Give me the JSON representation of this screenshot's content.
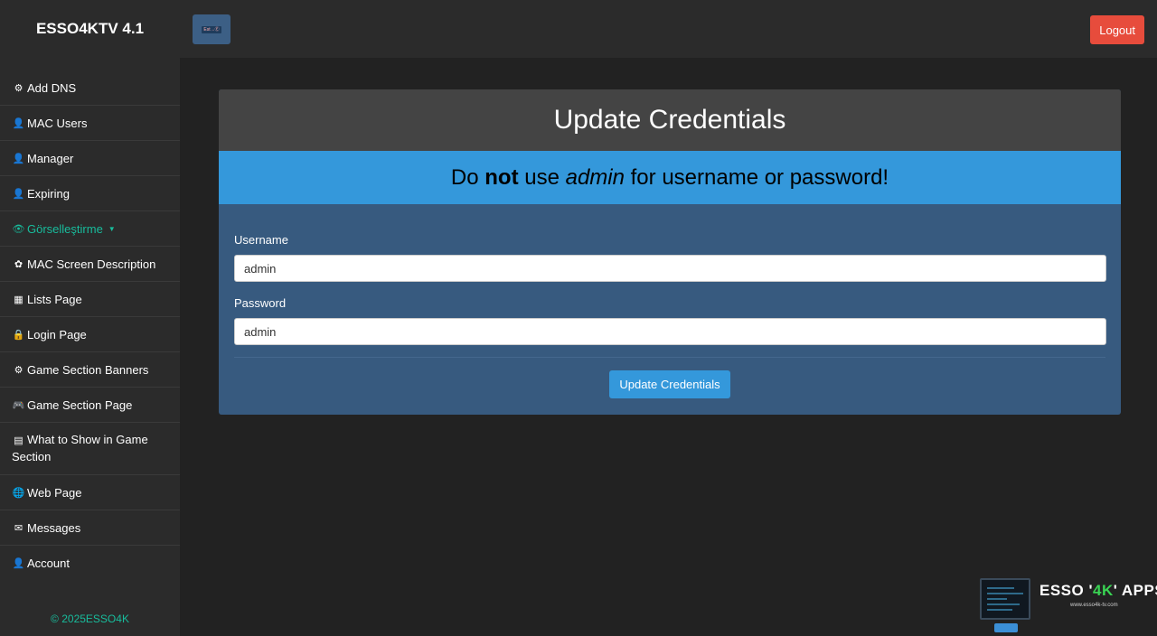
{
  "app": {
    "title": "ESSO4KTV 4.1"
  },
  "topbar": {
    "flag_label": "Est→Ⓔ",
    "logout_label": "Logout"
  },
  "sidebar": {
    "items": [
      {
        "icon": "⚙",
        "icon_name": "cogs-icon",
        "label": "Add DNS"
      },
      {
        "icon": "👤",
        "icon_name": "user-icon",
        "label": "MAC Users"
      },
      {
        "icon": "👤",
        "icon_name": "user-icon",
        "label": "Manager"
      },
      {
        "icon": "👤",
        "icon_name": "user-icon",
        "label": "Expiring"
      },
      {
        "icon": "👁",
        "icon_name": "eye-icon",
        "label": "Görselleştirme",
        "caret": "▼"
      },
      {
        "icon": "✿",
        "icon_name": "cog-icon",
        "label": "MAC Screen Description"
      },
      {
        "icon": "▦",
        "icon_name": "qrcode-icon",
        "label": "Lists Page"
      },
      {
        "icon": "🔒",
        "icon_name": "lock-icon",
        "label": "Login Page"
      },
      {
        "icon": "⚙",
        "icon_name": "cogs-icon",
        "label": "Game Section Banners"
      },
      {
        "icon": "🎮",
        "icon_name": "gamepad-icon",
        "label": "Game Section Page"
      },
      {
        "icon": "▤",
        "icon_name": "film-icon",
        "label": "What to Show in Game Section"
      },
      {
        "icon": "🌐",
        "icon_name": "globe-icon",
        "label": "Web Page"
      },
      {
        "icon": "✉",
        "icon_name": "envelope-icon",
        "label": "Messages"
      },
      {
        "icon": "👤",
        "icon_name": "user-icon",
        "label": "Account"
      }
    ],
    "footer": "© 2025ESSO4K"
  },
  "card": {
    "title": "Update Credentials",
    "warning": {
      "pre": "Do ",
      "bold": "not",
      "mid": " use ",
      "italic": "admin",
      "post": " for username or password!"
    },
    "username_label": "Username",
    "username_value": "admin",
    "password_label": "Password",
    "password_value": "admin",
    "submit_label": "Update Credentials"
  },
  "watermark": {
    "title_pre": "ESSO '",
    "title_4k": "4K",
    "title_post": "' APPS",
    "url": "www.esso4k-tv.com"
  },
  "colors": {
    "accent_green": "#18bc9c",
    "primary_blue": "#375a7f",
    "info_blue": "#3498db",
    "danger_red": "#e74c3c",
    "background": "#222222"
  }
}
